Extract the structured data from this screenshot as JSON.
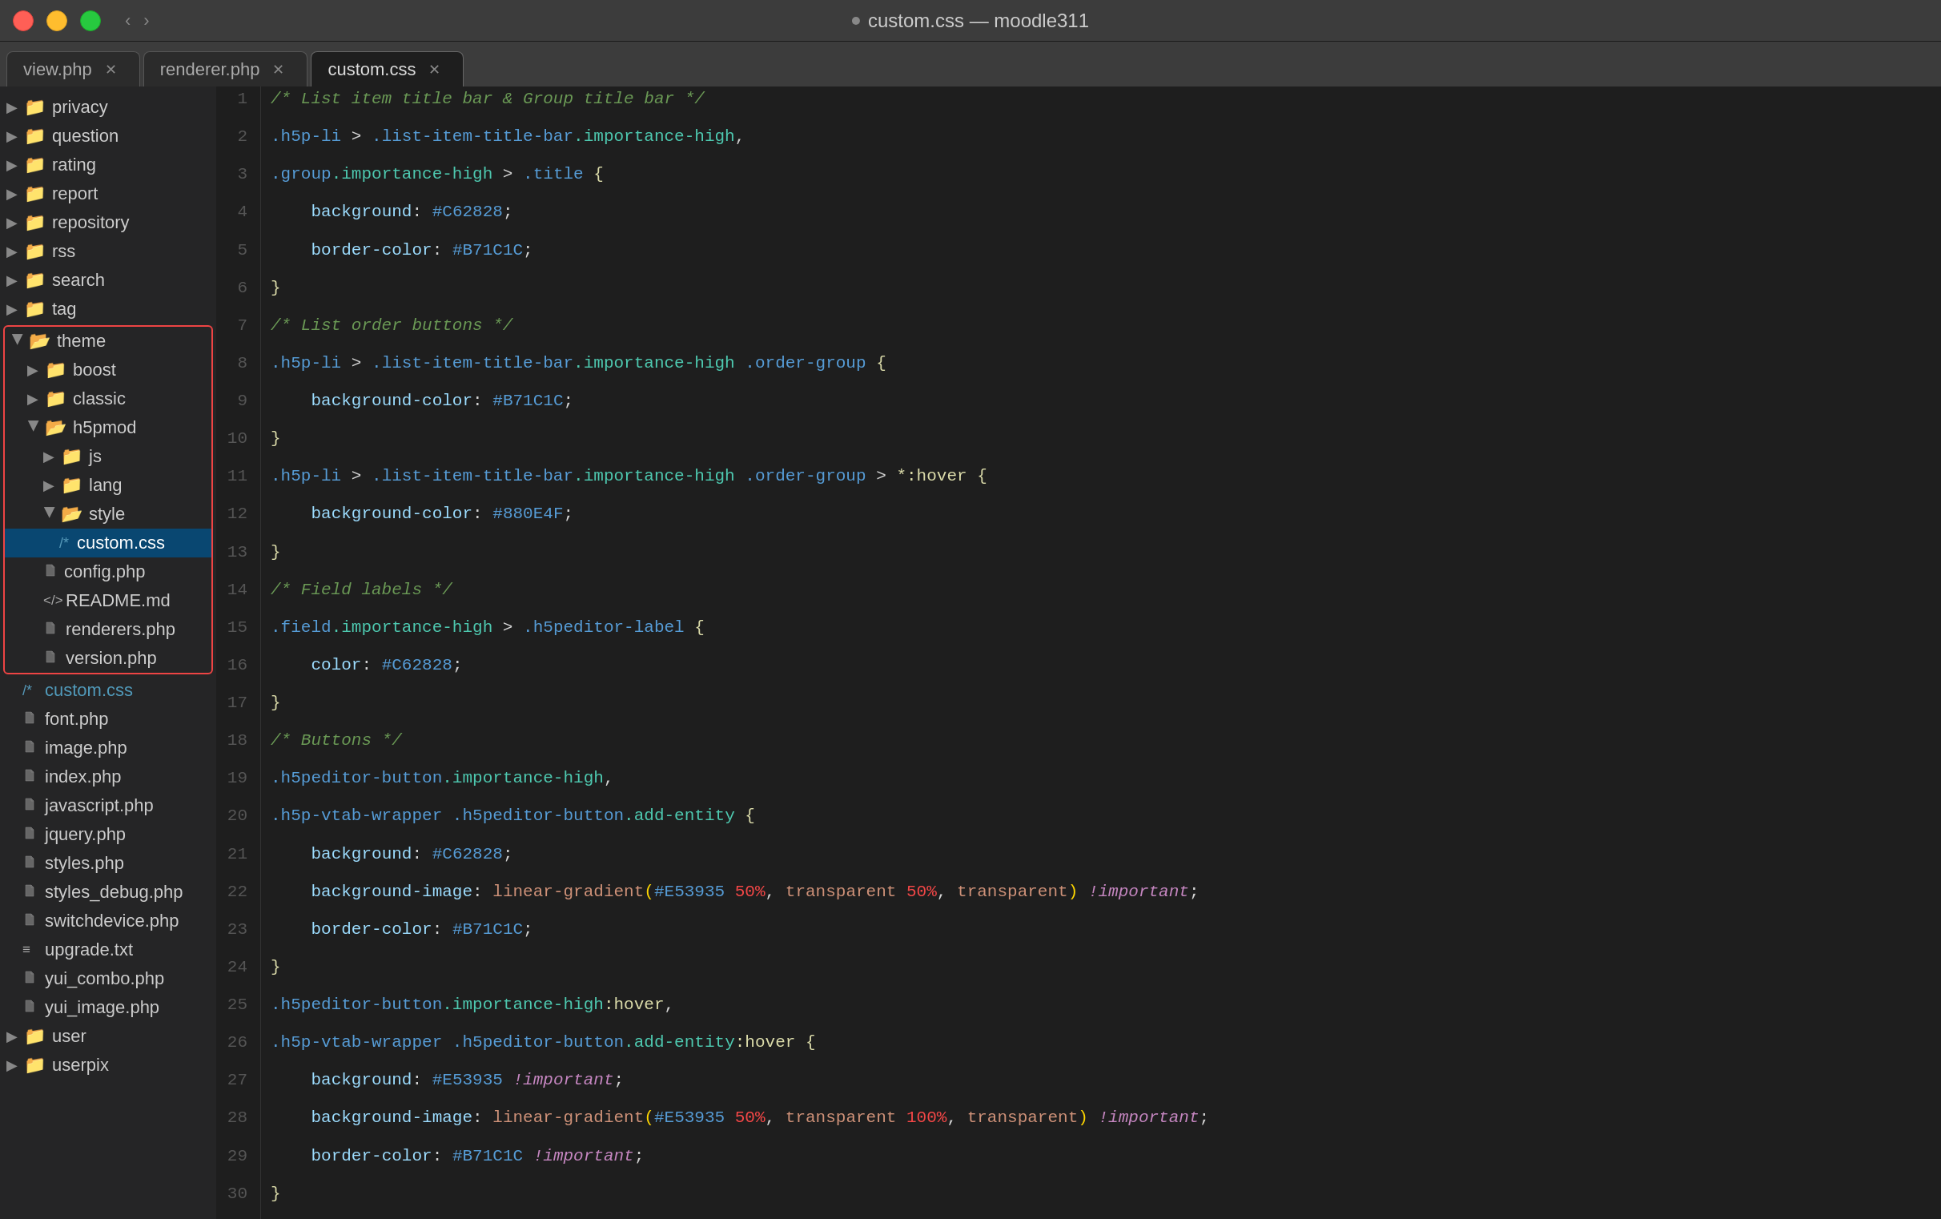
{
  "titlebar": {
    "title": "custom.css — moodle311",
    "back_arrow": "‹",
    "fwd_arrow": "›"
  },
  "tabs": [
    {
      "id": "view",
      "label": "view.php",
      "active": false,
      "closable": true
    },
    {
      "id": "renderer",
      "label": "renderer.php",
      "active": false,
      "closable": true
    },
    {
      "id": "custom",
      "label": "custom.css",
      "active": true,
      "closable": true
    }
  ],
  "sidebar": {
    "items": [
      {
        "id": "privacy",
        "type": "folder",
        "label": "privacy",
        "indent": 0,
        "open": false
      },
      {
        "id": "question",
        "type": "folder",
        "label": "question",
        "indent": 0,
        "open": false
      },
      {
        "id": "rating",
        "type": "folder",
        "label": "rating",
        "indent": 0,
        "open": false
      },
      {
        "id": "report",
        "type": "folder",
        "label": "report",
        "indent": 0,
        "open": false
      },
      {
        "id": "repository",
        "type": "folder",
        "label": "repository",
        "indent": 0,
        "open": false
      },
      {
        "id": "rss",
        "type": "folder",
        "label": "rss",
        "indent": 0,
        "open": false
      },
      {
        "id": "search",
        "type": "folder",
        "label": "search",
        "indent": 0,
        "open": false
      },
      {
        "id": "tag",
        "type": "folder",
        "label": "tag",
        "indent": 0,
        "open": false
      },
      {
        "id": "theme",
        "type": "folder",
        "label": "theme",
        "indent": 0,
        "open": true,
        "highlighted": true
      },
      {
        "id": "boost",
        "type": "folder",
        "label": "boost",
        "indent": 1,
        "open": false
      },
      {
        "id": "classic",
        "type": "folder",
        "label": "classic",
        "indent": 1,
        "open": false
      },
      {
        "id": "h5pmod",
        "type": "folder",
        "label": "h5pmod",
        "indent": 1,
        "open": true
      },
      {
        "id": "js",
        "type": "folder",
        "label": "js",
        "indent": 2,
        "open": false
      },
      {
        "id": "lang",
        "type": "folder",
        "label": "lang",
        "indent": 2,
        "open": false
      },
      {
        "id": "style",
        "type": "folder",
        "label": "style",
        "indent": 2,
        "open": true
      },
      {
        "id": "custom_css",
        "type": "file_css",
        "label": "custom.css",
        "prefix": "/* ",
        "indent": 3,
        "selected": true
      },
      {
        "id": "config_php",
        "type": "file_php",
        "label": "config.php",
        "indent": 2
      },
      {
        "id": "readme_md",
        "type": "file_md",
        "label": "README.md",
        "prefix": "<> ",
        "indent": 2
      },
      {
        "id": "renderers_php",
        "type": "file_php",
        "label": "renderers.php",
        "indent": 2
      },
      {
        "id": "version_php",
        "type": "file_php",
        "label": "version.php",
        "indent": 2
      },
      {
        "id": "custom_css2",
        "type": "file_css",
        "label": "custom.css",
        "prefix": "/* ",
        "indent": 1
      },
      {
        "id": "font_php",
        "type": "file_php",
        "label": "font.php",
        "indent": 1
      },
      {
        "id": "image_php",
        "type": "file_php",
        "label": "image.php",
        "indent": 1
      },
      {
        "id": "index_php",
        "type": "file_php",
        "label": "index.php",
        "indent": 1
      },
      {
        "id": "javascript_php",
        "type": "file_php",
        "label": "javascript.php",
        "indent": 1
      },
      {
        "id": "jquery_php",
        "type": "file_php",
        "label": "jquery.php",
        "indent": 1
      },
      {
        "id": "styles_php",
        "type": "file_php",
        "label": "styles.php",
        "indent": 1
      },
      {
        "id": "styles_debug_php",
        "type": "file_php",
        "label": "styles_debug.php",
        "indent": 1
      },
      {
        "id": "switchdevice_php",
        "type": "file_php",
        "label": "switchdevice.php",
        "indent": 1
      },
      {
        "id": "upgrade_txt",
        "type": "file_txt",
        "label": "upgrade.txt",
        "indent": 1
      },
      {
        "id": "yui_combo_php",
        "type": "file_php",
        "label": "yui_combo.php",
        "indent": 1
      },
      {
        "id": "yui_image_php",
        "type": "file_php",
        "label": "yui_image.php",
        "indent": 1
      },
      {
        "id": "user",
        "type": "folder",
        "label": "user",
        "indent": 0,
        "open": false
      },
      {
        "id": "userpix",
        "type": "folder",
        "label": "userpix",
        "indent": 0,
        "open": false
      }
    ]
  },
  "code": {
    "lines": [
      {
        "num": 1,
        "content_raw": "/* List item title bar & Group title bar */"
      },
      {
        "num": 2,
        "content_raw": ".h5p-li > .list-item-title-bar.importance-high,"
      },
      {
        "num": 3,
        "content_raw": ".group.importance-high > .title {"
      },
      {
        "num": 4,
        "content_raw": "    background: #C62828;"
      },
      {
        "num": 5,
        "content_raw": "    border-color: #B71C1C;"
      },
      {
        "num": 6,
        "content_raw": "}"
      },
      {
        "num": 7,
        "content_raw": "/* List order buttons */"
      },
      {
        "num": 8,
        "content_raw": ".h5p-li > .list-item-title-bar.importance-high .order-group {"
      },
      {
        "num": 9,
        "content_raw": "    background-color: #B71C1C;"
      },
      {
        "num": 10,
        "content_raw": "}"
      },
      {
        "num": 11,
        "content_raw": ".h5p-li > .list-item-title-bar.importance-high .order-group > *:hover {"
      },
      {
        "num": 12,
        "content_raw": "    background-color: #880E4F;"
      },
      {
        "num": 13,
        "content_raw": "}"
      },
      {
        "num": 14,
        "content_raw": "/* Field labels */"
      },
      {
        "num": 15,
        "content_raw": ".field.importance-high > .h5peditor-label {"
      },
      {
        "num": 16,
        "content_raw": "    color: #C62828;"
      },
      {
        "num": 17,
        "content_raw": "}"
      },
      {
        "num": 18,
        "content_raw": "/* Buttons */"
      },
      {
        "num": 19,
        "content_raw": ".h5peditor-button.importance-high,"
      },
      {
        "num": 20,
        "content_raw": ".h5p-vtab-wrapper .h5peditor-button.add-entity {"
      },
      {
        "num": 21,
        "content_raw": "    background: #C62828;"
      },
      {
        "num": 22,
        "content_raw": "    background-image: linear-gradient(#E53935 50%, transparent 50%, transparent) !important;"
      },
      {
        "num": 23,
        "content_raw": "    border-color: #B71C1C;"
      },
      {
        "num": 24,
        "content_raw": "}"
      },
      {
        "num": 25,
        "content_raw": ".h5peditor-button.importance-high:hover,"
      },
      {
        "num": 26,
        "content_raw": ".h5p-vtab-wrapper .h5peditor-button.add-entity:hover {"
      },
      {
        "num": 27,
        "content_raw": "    background: #E53935 !important;"
      },
      {
        "num": 28,
        "content_raw": "    background-image: linear-gradient(#E53935 50%, transparent 100%, transparent) !important;"
      },
      {
        "num": 29,
        "content_raw": "    border-color: #B71C1C !important;"
      },
      {
        "num": 30,
        "content_raw": "}"
      }
    ]
  }
}
